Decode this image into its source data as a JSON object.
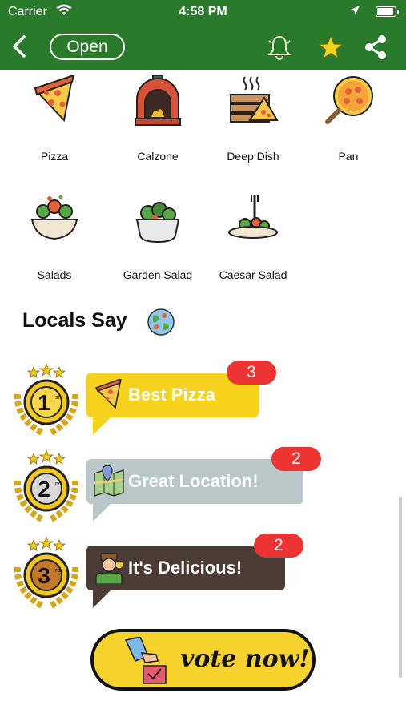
{
  "status": {
    "carrier": "Carrier",
    "time": "4:58 PM"
  },
  "nav": {
    "open_label": "Open"
  },
  "categories": [
    {
      "label": "Pizza",
      "icon": "pizza-slice-icon"
    },
    {
      "label": "Calzone",
      "icon": "brick-oven-icon"
    },
    {
      "label": "Deep Dish",
      "icon": "pizza-boxes-icon"
    },
    {
      "label": "Pan",
      "icon": "pizza-pan-icon"
    },
    {
      "label": "Salads",
      "icon": "salad-bowl-icon"
    },
    {
      "label": "Garden Salad",
      "icon": "garden-salad-icon"
    },
    {
      "label": "Caesar Salad",
      "icon": "caesar-salad-icon"
    }
  ],
  "locals": {
    "title": "Locals Say",
    "items": [
      {
        "rank": "1",
        "suffix": "st",
        "label": "Best Pizza",
        "count": "3",
        "color": "#f6d21d"
      },
      {
        "rank": "2",
        "suffix": "nd",
        "label": "Great Location!",
        "count": "2",
        "color": "#b9c7c9"
      },
      {
        "rank": "3",
        "suffix": "rd",
        "label": "It's Delicious!",
        "count": "2",
        "color": "#4a3b34"
      }
    ]
  },
  "vote": {
    "label": "vote now!"
  },
  "colors": {
    "header_green": "#2a7a2c",
    "badge_red": "#ee3333",
    "vote_yellow": "#f5d22c"
  }
}
